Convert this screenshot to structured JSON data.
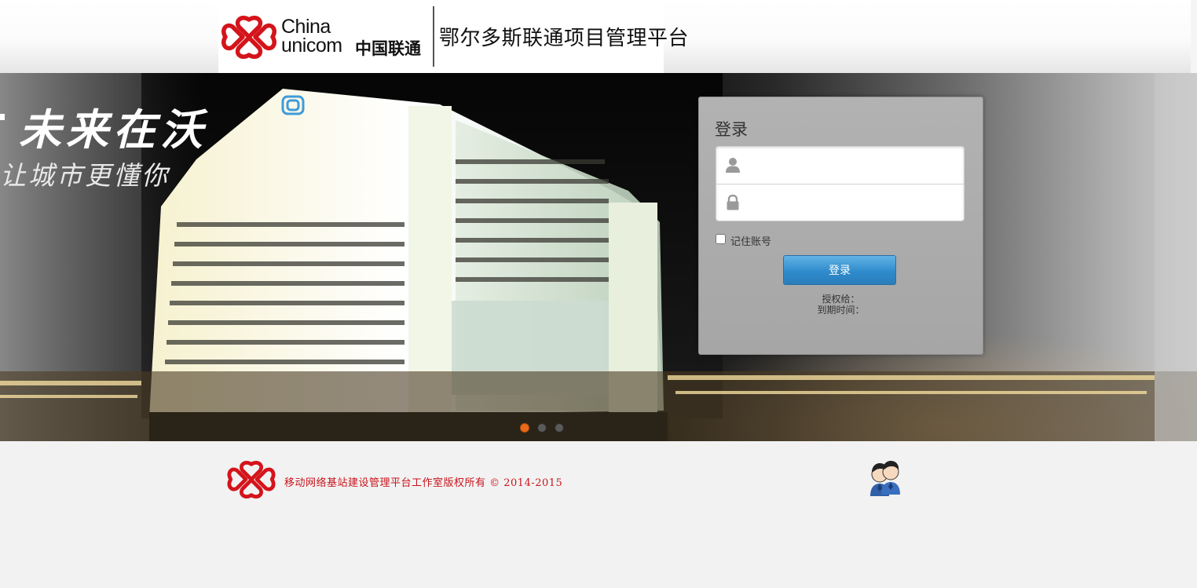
{
  "header": {
    "brand_latin_line1": "China",
    "brand_latin_line2": "unicom",
    "brand_cn": "中国联通",
    "platform_title": "鄂尔多斯联通项目管理平台"
  },
  "banner": {
    "slogan_main": "未来在沃",
    "slogan_sub": "让城市更懂你",
    "slides": [
      {
        "active": true
      },
      {
        "active": false
      },
      {
        "active": false
      }
    ]
  },
  "login": {
    "title": "登录",
    "username_placeholder": "",
    "password_placeholder": "",
    "remember_label": "记住账号",
    "remember_checked": false,
    "submit_label": "登录",
    "licensed_to_label": "授权给：",
    "expiry_label": "到期时间："
  },
  "footer": {
    "copyright": "移动网络基站建设管理平台工作室版权所有 © 2014-2015"
  },
  "icons": {
    "logo": "china-unicom-knot-icon",
    "user": "user-icon",
    "lock": "lock-icon",
    "support": "customer-service-icon"
  },
  "colors": {
    "brand_red": "#d4141b",
    "button_blue": "#2f8ccc",
    "active_dot": "#e86b1c"
  }
}
